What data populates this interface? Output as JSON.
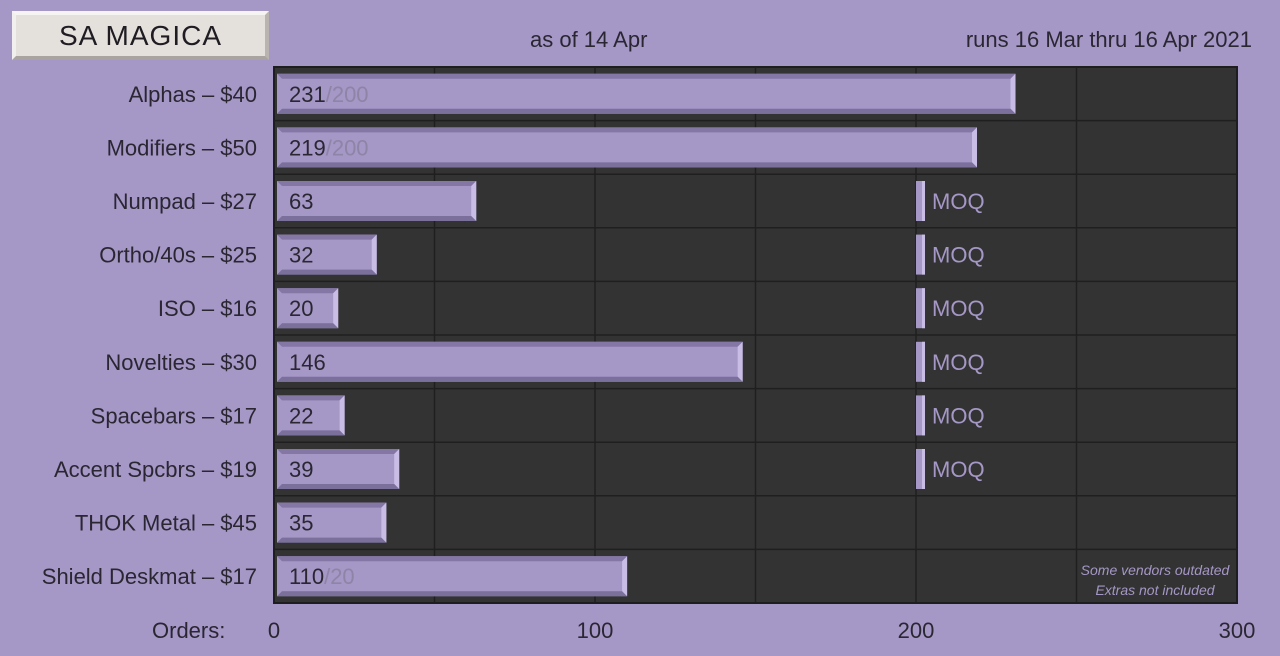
{
  "header": {
    "title": "SA MAGICA",
    "as_of": "as of 14 Apr",
    "runs": "runs 16 Mar thru 16 Apr 2021"
  },
  "colors": {
    "background": "#a597c6",
    "plot_bg": "#333333",
    "bar": "#a597c6"
  },
  "chart_data": {
    "type": "bar",
    "orientation": "horizontal",
    "xlabel": "Orders:",
    "xlim": [
      0,
      300
    ],
    "xticks": [
      0,
      100,
      200,
      300
    ],
    "grid": true,
    "categories": [
      "Alphas – $40",
      "Modifiers – $50",
      "Numpad – $27",
      "Ortho/40s – $25",
      "ISO – $16",
      "Novelties – $30",
      "Spacebars – $17",
      "Accent Spcbrs – $19",
      "THOK Metal – $45",
      "Shield Deskmat – $17"
    ],
    "values": [
      231,
      219,
      63,
      32,
      20,
      146,
      22,
      39,
      35,
      110
    ],
    "targets": [
      "/200",
      "/200",
      "",
      "",
      "",
      "",
      "",
      "",
      "",
      "/20"
    ],
    "moq": [
      null,
      null,
      200,
      200,
      200,
      200,
      200,
      200,
      null,
      null
    ],
    "moq_label": "MOQ",
    "notes": [
      "Some vendors outdated",
      "Extras not included"
    ]
  }
}
